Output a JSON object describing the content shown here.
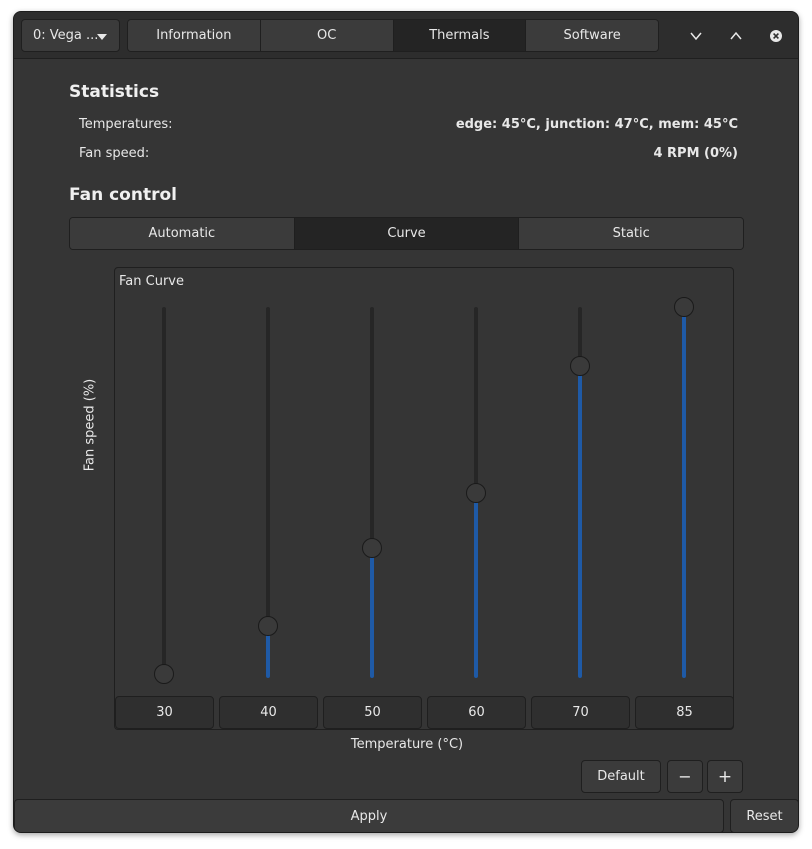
{
  "header": {
    "gpu_selector": "0: Vega ...",
    "tabs": [
      {
        "label": "Information",
        "active": false
      },
      {
        "label": "OC",
        "active": false
      },
      {
        "label": "Thermals",
        "active": true
      },
      {
        "label": "Software",
        "active": false
      }
    ],
    "icons": [
      "chevron-down-icon",
      "chevron-up-icon",
      "close-icon"
    ]
  },
  "statistics": {
    "title": "Statistics",
    "temperatures_label": "Temperatures:",
    "temperatures_value": "edge: 45°C, junction: 47°C, mem: 45°C",
    "fan_speed_label": "Fan speed:",
    "fan_speed_value": "4 RPM (0%)"
  },
  "fan_control": {
    "title": "Fan control",
    "modes": [
      {
        "label": "Automatic",
        "active": false
      },
      {
        "label": "Curve",
        "active": true
      },
      {
        "label": "Static",
        "active": false
      }
    ],
    "curve_title": "Fan Curve",
    "y_label": "Fan speed (%)",
    "x_label": "Temperature (°C)",
    "points": [
      {
        "temperature": "30",
        "speed_fraction": 0.0
      },
      {
        "temperature": "40",
        "speed_fraction": 0.14
      },
      {
        "temperature": "50",
        "speed_fraction": 0.35
      },
      {
        "temperature": "60",
        "speed_fraction": 0.5
      },
      {
        "temperature": "70",
        "speed_fraction": 0.84
      },
      {
        "temperature": "85",
        "speed_fraction": 1.0
      }
    ],
    "default_label": "Default",
    "remove_symbol": "−",
    "add_symbol": "+"
  },
  "footer": {
    "apply_label": "Apply",
    "reset_label": "Reset"
  },
  "colors": {
    "accent": "#1f5aa6",
    "background": "#353535"
  }
}
